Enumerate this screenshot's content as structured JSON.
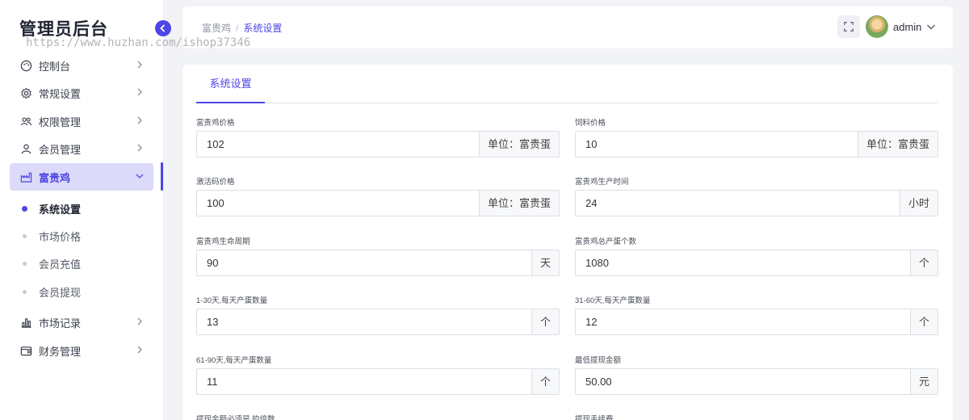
{
  "sidebar": {
    "brand": "管理员后台",
    "watermark": "https://www.huzhan.com/ishop37346",
    "items": [
      {
        "label": "控制台"
      },
      {
        "label": "常规设置"
      },
      {
        "label": "权限管理"
      },
      {
        "label": "会员管理"
      },
      {
        "label": "富贵鸡"
      },
      {
        "label": "市场记录"
      },
      {
        "label": "财务管理"
      }
    ],
    "sub_items": [
      {
        "label": "系统设置"
      },
      {
        "label": "市场价格"
      },
      {
        "label": "会员充值"
      },
      {
        "label": "会员提现"
      }
    ]
  },
  "header": {
    "breadcrumb": [
      "富贵鸡",
      "系统设置"
    ],
    "breadcrumb_sep": "/",
    "user": "admin"
  },
  "tabs": [
    {
      "label": "系统设置"
    }
  ],
  "fields": [
    {
      "label": "富贵鸡价格",
      "value": "102",
      "suffix": "单位：富贵蛋"
    },
    {
      "label": "饲料价格",
      "value": "10",
      "suffix": "单位：富贵蛋"
    },
    {
      "label": "激活码价格",
      "value": "100",
      "suffix": "单位：富贵蛋"
    },
    {
      "label": "富贵鸡生产时间",
      "value": "24",
      "suffix": "小时"
    },
    {
      "label": "富贵鸡生命周期",
      "value": "90",
      "suffix": "天"
    },
    {
      "label": "富贵鸡总产蛋个数",
      "value": "1080",
      "suffix": "个"
    },
    {
      "label": "1-30天,每天产蛋数量",
      "value": "13",
      "suffix": "个"
    },
    {
      "label": "31-60天,每天产蛋数量",
      "value": "12",
      "suffix": "个"
    },
    {
      "label": "61-90天,每天产蛋数量",
      "value": "11",
      "suffix": "个"
    },
    {
      "label": "最低提现金额",
      "value": "50.00",
      "suffix": "元"
    },
    {
      "label": "提现金额必须是   的倍数"
    },
    {
      "label": "提现手续费"
    }
  ]
}
